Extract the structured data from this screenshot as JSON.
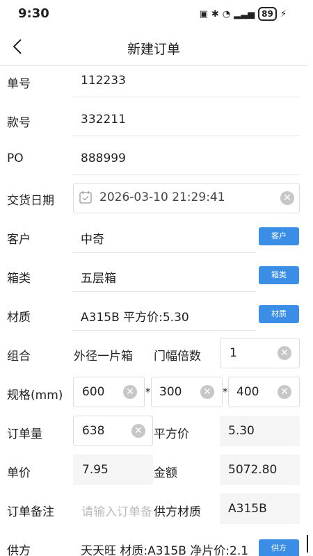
{
  "status": {
    "time": "9:30",
    "battery": "89"
  },
  "header": {
    "title": "新建订单"
  },
  "form": {
    "order_no": {
      "label": "单号",
      "value": "112233"
    },
    "style_no": {
      "label": "款号",
      "value": "332211"
    },
    "po": {
      "label": "PO",
      "value": "888999"
    },
    "delivery_date": {
      "label": "交货日期",
      "value": "2026-03-10 21:29:41"
    },
    "customer": {
      "label": "客户",
      "value": "中奇",
      "button": "客户"
    },
    "box_type": {
      "label": "箱类",
      "value": "五层箱",
      "button": "箱类"
    },
    "material": {
      "label": "材质",
      "value": "A315B 平方价:5.30",
      "button": "材质"
    },
    "combination": {
      "label": "组合",
      "value": "外径一片箱",
      "door_label": "门幅倍数",
      "door_value": "1"
    },
    "spec": {
      "label": "规格(mm)",
      "l": "600",
      "w": "300",
      "h": "400",
      "sep": "*"
    },
    "quantity": {
      "label": "订单量",
      "value": "638",
      "price_label": "平方价",
      "price_value": "5.30"
    },
    "unit_price": {
      "label": "单价",
      "value": "7.95",
      "amount_label": "金额",
      "amount_value": "5072.80"
    },
    "remark": {
      "label": "订单备注",
      "placeholder": "请输入订单备注",
      "supplier_material_label": "供方材质",
      "supplier_material_value": "A315B"
    },
    "supplier": {
      "label": "供方",
      "value": "天天旺 材质:A315B 净片价:2.1",
      "button": "供方"
    }
  }
}
